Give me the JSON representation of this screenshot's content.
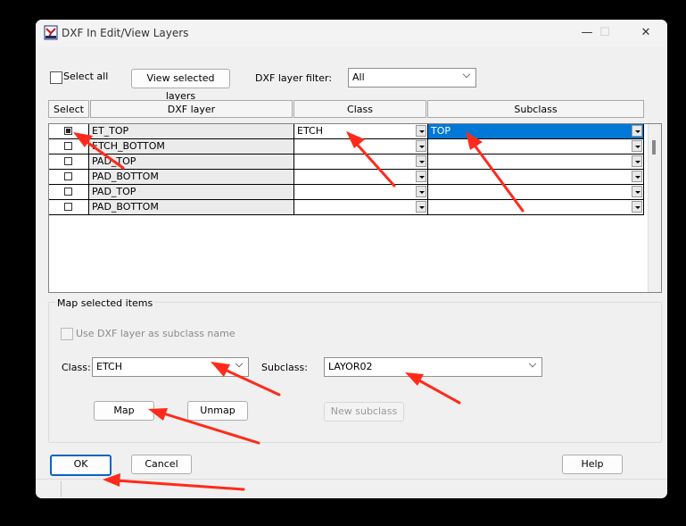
{
  "window": {
    "title": "DXF In Edit/View Layers",
    "minimize": "—",
    "maximize": "☐",
    "close": "✕"
  },
  "toolbar": {
    "select_all_label": "Select all",
    "view_selected_label": "View selected layers",
    "filter_label": "DXF layer filter:",
    "filter_value": "All"
  },
  "grid": {
    "headers": {
      "select": "Select",
      "layer": "DXF layer",
      "class": "Class",
      "subclass": "Subclass"
    },
    "rows": [
      {
        "checked": true,
        "layer": "ET_TOP",
        "class": "ETCH",
        "subclass": "TOP"
      },
      {
        "checked": false,
        "layer": "ETCH_BOTTOM",
        "class": "",
        "subclass": ""
      },
      {
        "checked": false,
        "layer": "PAD_TOP",
        "class": "",
        "subclass": ""
      },
      {
        "checked": false,
        "layer": "PAD_BOTTOM",
        "class": "",
        "subclass": ""
      },
      {
        "checked": false,
        "layer": "PAD_TOP",
        "class": "",
        "subclass": ""
      },
      {
        "checked": false,
        "layer": "PAD_BOTTOM",
        "class": "",
        "subclass": ""
      }
    ]
  },
  "map": {
    "group_label": "Map selected items",
    "use_dxf_label": "Use DXF layer as subclass name",
    "class_label": "Class:",
    "class_value": "ETCH",
    "subclass_label": "Subclass:",
    "subclass_value": "LAYOR02",
    "map_button": "Map",
    "unmap_button": "Unmap",
    "new_subclass_button": "New subclass"
  },
  "footer": {
    "ok": "OK",
    "cancel": "Cancel",
    "help": "Help"
  },
  "colors": {
    "selection": "#0078d7",
    "annotation_arrow": "#ff2a1a",
    "default_button_border": "#0a64c8"
  }
}
